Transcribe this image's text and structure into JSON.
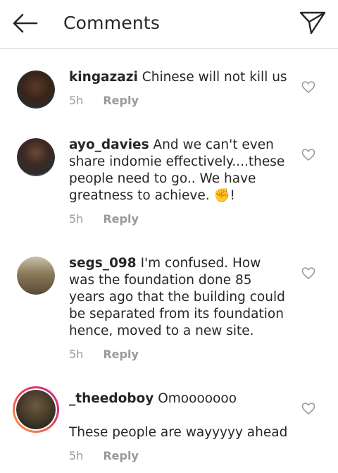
{
  "header": {
    "title": "Comments",
    "back_icon": "arrow-left-icon",
    "share_icon": "paper-plane-icon"
  },
  "comments": [
    {
      "username": "kingazazi",
      "text": "Chinese will not kill us",
      "time": "5h",
      "reply_label": "Reply"
    },
    {
      "username": "ayo_davies",
      "text": "And we can't even share indomie effectively....these people need to go.. We have greatness to achieve. ✊!",
      "time": "5h",
      "reply_label": "Reply"
    },
    {
      "username": "segs_098",
      "text": "I'm confused. How was the foundation done 85 years ago that the building could be separated from its foundation hence, moved to a new site.",
      "time": "5h",
      "reply_label": "Reply"
    },
    {
      "username": "_theedoboy",
      "text": "Omooooooo",
      "text_line2": "These people are wayyyyy ahead",
      "time": "5h",
      "reply_label": "Reply"
    }
  ],
  "colors": {
    "text": "#262626",
    "meta": "#999999",
    "divider": "#dbdbdb",
    "story_ring_start": "#f9a13f",
    "story_ring_end": "#c2258f"
  }
}
